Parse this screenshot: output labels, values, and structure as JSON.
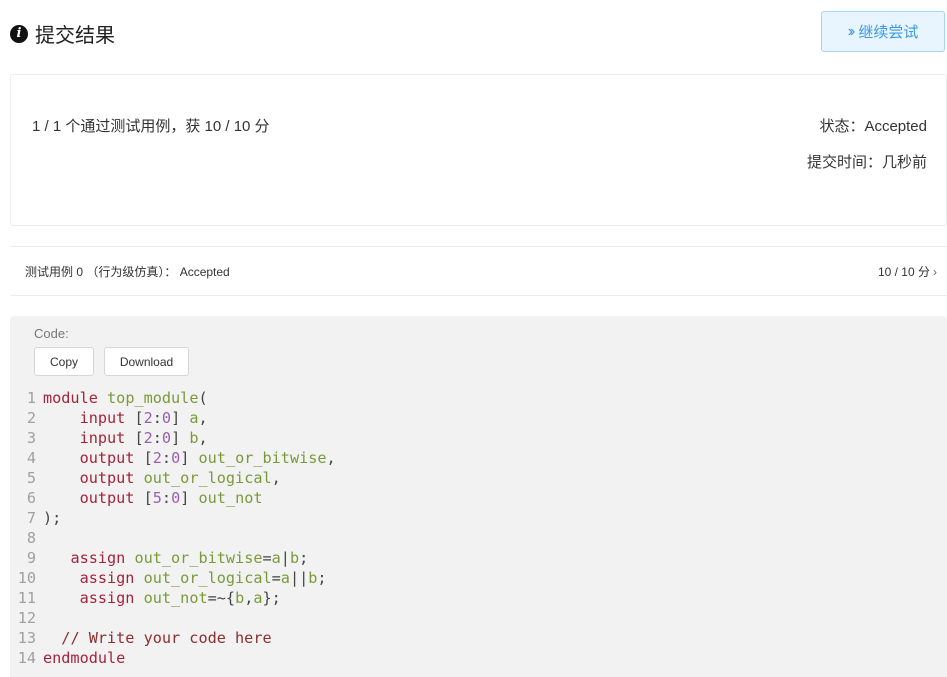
{
  "header": {
    "title": "提交结果",
    "continue_label": "继续尝试"
  },
  "summary": {
    "result_text": "1 / 1 个通过测试用例，获 10 / 10 分",
    "status_label": "状态：",
    "status_value": "Accepted",
    "time_label": "提交时间：",
    "time_value": "几秒前"
  },
  "testcase": {
    "label": "测试用例 0 （行为级仿真）：",
    "status": "Accepted",
    "score": "10 / 10 分"
  },
  "code_panel": {
    "caption": "Code:",
    "copy_label": "Copy",
    "download_label": "Download"
  },
  "code_lines": [
    {
      "n": "1",
      "tokens": [
        [
          "kw",
          "module"
        ],
        [
          "p",
          " "
        ],
        [
          "id",
          "top_module"
        ],
        [
          "p",
          "("
        ]
      ]
    },
    {
      "n": "2",
      "tokens": [
        [
          "p",
          "    "
        ],
        [
          "kw",
          "input"
        ],
        [
          "p",
          " ["
        ],
        [
          "num",
          "2"
        ],
        [
          "p",
          ":"
        ],
        [
          "num",
          "0"
        ],
        [
          "p",
          "] "
        ],
        [
          "id",
          "a"
        ],
        [
          "p",
          ","
        ]
      ]
    },
    {
      "n": "3",
      "tokens": [
        [
          "p",
          "    "
        ],
        [
          "kw",
          "input"
        ],
        [
          "p",
          " ["
        ],
        [
          "num",
          "2"
        ],
        [
          "p",
          ":"
        ],
        [
          "num",
          "0"
        ],
        [
          "p",
          "] "
        ],
        [
          "id",
          "b"
        ],
        [
          "p",
          ","
        ]
      ]
    },
    {
      "n": "4",
      "tokens": [
        [
          "p",
          "    "
        ],
        [
          "kw",
          "output"
        ],
        [
          "p",
          " ["
        ],
        [
          "num",
          "2"
        ],
        [
          "p",
          ":"
        ],
        [
          "num",
          "0"
        ],
        [
          "p",
          "] "
        ],
        [
          "id",
          "out_or_bitwise"
        ],
        [
          "p",
          ","
        ]
      ]
    },
    {
      "n": "5",
      "tokens": [
        [
          "p",
          "    "
        ],
        [
          "kw",
          "output"
        ],
        [
          "p",
          " "
        ],
        [
          "id",
          "out_or_logical"
        ],
        [
          "p",
          ","
        ]
      ]
    },
    {
      "n": "6",
      "tokens": [
        [
          "p",
          "    "
        ],
        [
          "kw",
          "output"
        ],
        [
          "p",
          " ["
        ],
        [
          "num",
          "5"
        ],
        [
          "p",
          ":"
        ],
        [
          "num",
          "0"
        ],
        [
          "p",
          "] "
        ],
        [
          "id",
          "out_not"
        ]
      ]
    },
    {
      "n": "7",
      "tokens": [
        [
          "p",
          ");"
        ]
      ]
    },
    {
      "n": "8",
      "tokens": []
    },
    {
      "n": "9",
      "tokens": [
        [
          "p",
          "   "
        ],
        [
          "kw",
          "assign"
        ],
        [
          "p",
          " "
        ],
        [
          "id",
          "out_or_bitwise"
        ],
        [
          "p",
          "="
        ],
        [
          "id",
          "a"
        ],
        [
          "p",
          "|"
        ],
        [
          "id",
          "b"
        ],
        [
          "p",
          ";"
        ]
      ]
    },
    {
      "n": "10",
      "tokens": [
        [
          "p",
          "    "
        ],
        [
          "kw",
          "assign"
        ],
        [
          "p",
          " "
        ],
        [
          "id",
          "out_or_logical"
        ],
        [
          "p",
          "="
        ],
        [
          "id",
          "a"
        ],
        [
          "p",
          "||"
        ],
        [
          "id",
          "b"
        ],
        [
          "p",
          ";"
        ]
      ]
    },
    {
      "n": "11",
      "tokens": [
        [
          "p",
          "    "
        ],
        [
          "kw",
          "assign"
        ],
        [
          "p",
          " "
        ],
        [
          "id",
          "out_not"
        ],
        [
          "p",
          "=~{"
        ],
        [
          "id",
          "b"
        ],
        [
          "p",
          ","
        ],
        [
          "id",
          "a"
        ],
        [
          "p",
          "};"
        ]
      ]
    },
    {
      "n": "12",
      "tokens": []
    },
    {
      "n": "13",
      "tokens": [
        [
          "p",
          "  "
        ],
        [
          "cm",
          "// Write your code here"
        ]
      ]
    },
    {
      "n": "14",
      "tokens": [
        [
          "kw",
          "endmodule"
        ]
      ]
    }
  ],
  "colors": {
    "keyword": "#a4243b",
    "identifier": "#7a9a3a",
    "number": "#9a5fb0",
    "comment": "#8a2f2f",
    "accent": "#3a9ae8"
  }
}
